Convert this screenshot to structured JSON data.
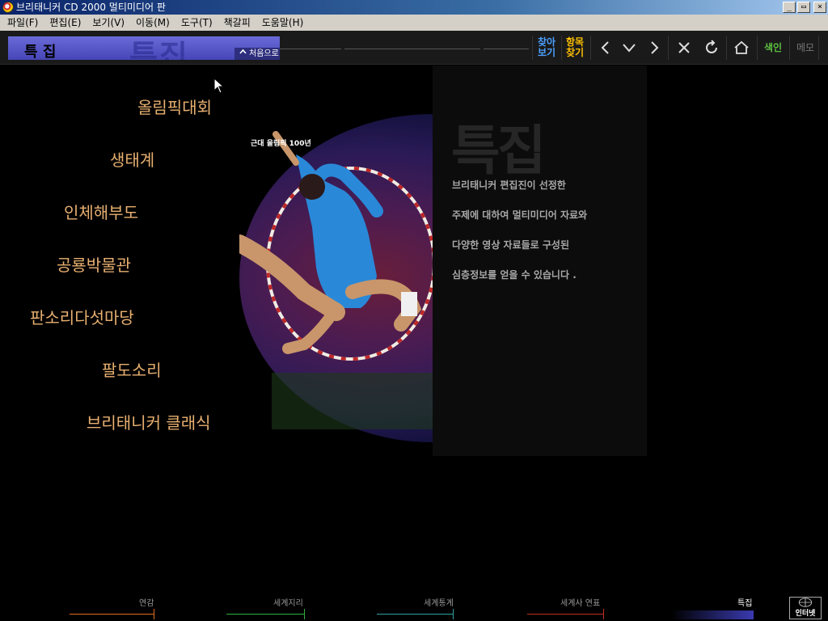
{
  "titlebar": {
    "title": "브리태니커 CD 2000 멀티미디어 판",
    "minimize": "_",
    "maximize": "▭",
    "close": "×"
  },
  "menubar": {
    "items": [
      "파일(F)",
      "편집(E)",
      "보기(V)",
      "이동(M)",
      "도구(T)",
      "책갈피",
      "도움말(H)"
    ]
  },
  "toolbar": {
    "section_title": "특 집",
    "section_ghost": "특집",
    "home_label": "처음으로",
    "browse_label_1": "찾아",
    "browse_label_2": "보기",
    "item_find_label_1": "항목",
    "item_find_label_2": "찾기",
    "index_label": "색인",
    "memo_label": "메모",
    "colors": {
      "browse": "#4aa0ff",
      "item_find": "#ffc000",
      "index": "#5cc040",
      "memo": "#777777"
    }
  },
  "left_menu": {
    "items": [
      "올림픽대회",
      "생태계",
      "인체해부도",
      "공룡박물관",
      "판소리다섯마당",
      "팔도소리",
      "브리태니커 클래식"
    ]
  },
  "feature": {
    "caption": "근대 올림픽 100년",
    "big_title": "특집",
    "description": [
      "브리태니커 편집진이 선정한",
      "주제에 대하여 멀티미디어 자료와",
      "다양한 영상 자료들로 구성된",
      "심층정보를 얻을 수 있습니다 ."
    ]
  },
  "bottom_nav": {
    "items": [
      "연감",
      "세계지리",
      "세계통계",
      "세계사 연표",
      "특집"
    ],
    "colors": [
      "#e07020",
      "#30b040",
      "#30a0a0",
      "#c03020",
      "#3a3ab0"
    ],
    "internet_label": "인터넷"
  }
}
